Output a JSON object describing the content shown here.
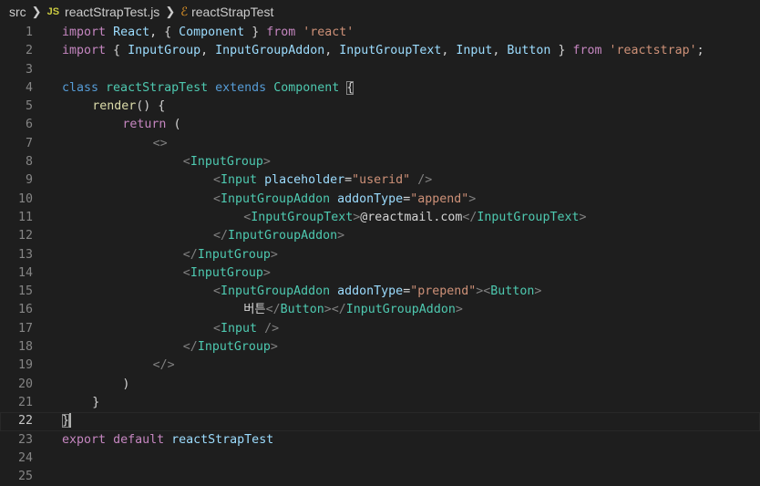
{
  "breadcrumb": {
    "folder": "src",
    "file_badge": "JS",
    "file": "reactStrapTest.js",
    "symbol": "reactStrapTest"
  },
  "editor": {
    "current_line": 22,
    "lines": [
      {
        "n": "1",
        "indent": 0,
        "tokens": [
          [
            "kw",
            "import"
          ],
          [
            "txt",
            " "
          ],
          [
            "var",
            "React"
          ],
          [
            "txt",
            ", { "
          ],
          [
            "var",
            "Component"
          ],
          [
            "txt",
            " } "
          ],
          [
            "kw",
            "from"
          ],
          [
            "txt",
            " "
          ],
          [
            "str",
            "'react'"
          ]
        ]
      },
      {
        "n": "2",
        "indent": 0,
        "tokens": [
          [
            "kw",
            "import"
          ],
          [
            "txt",
            " { "
          ],
          [
            "var",
            "InputGroup"
          ],
          [
            "txt",
            ", "
          ],
          [
            "var",
            "InputGroupAddon"
          ],
          [
            "txt",
            ", "
          ],
          [
            "var",
            "InputGroupText"
          ],
          [
            "txt",
            ", "
          ],
          [
            "var",
            "Input"
          ],
          [
            "txt",
            ", "
          ],
          [
            "var",
            "Button"
          ],
          [
            "txt",
            " } "
          ],
          [
            "kw",
            "from"
          ],
          [
            "txt",
            " "
          ],
          [
            "str",
            "'reactstrap'"
          ],
          [
            "txt",
            ";"
          ]
        ]
      },
      {
        "n": "3",
        "indent": 0,
        "tokens": []
      },
      {
        "n": "4",
        "indent": 0,
        "tokens": [
          [
            "kw2",
            "class"
          ],
          [
            "txt",
            " "
          ],
          [
            "type",
            "reactStrapTest"
          ],
          [
            "txt",
            " "
          ],
          [
            "kw2",
            "extends"
          ],
          [
            "txt",
            " "
          ],
          [
            "type",
            "Component"
          ],
          [
            "txt",
            " "
          ],
          [
            "bm",
            "{"
          ]
        ]
      },
      {
        "n": "5",
        "indent": 1,
        "tokens": [
          [
            "fn",
            "render"
          ],
          [
            "txt",
            "() {"
          ]
        ]
      },
      {
        "n": "6",
        "indent": 2,
        "tokens": [
          [
            "kw",
            "return"
          ],
          [
            "txt",
            " ("
          ]
        ]
      },
      {
        "n": "7",
        "indent": 3,
        "tokens": [
          [
            "tag-p",
            "<>"
          ]
        ]
      },
      {
        "n": "8",
        "indent": 4,
        "tokens": [
          [
            "tag-p",
            "<"
          ],
          [
            "tag",
            "InputGroup"
          ],
          [
            "tag-p",
            ">"
          ]
        ]
      },
      {
        "n": "9",
        "indent": 5,
        "tokens": [
          [
            "tag-p",
            "<"
          ],
          [
            "tag",
            "Input"
          ],
          [
            "txt",
            " "
          ],
          [
            "attr",
            "placeholder"
          ],
          [
            "txt",
            "="
          ],
          [
            "str",
            "\"userid\""
          ],
          [
            "txt",
            " "
          ],
          [
            "tag-p",
            "/>"
          ]
        ]
      },
      {
        "n": "10",
        "indent": 5,
        "tokens": [
          [
            "tag-p",
            "<"
          ],
          [
            "tag",
            "InputGroupAddon"
          ],
          [
            "txt",
            " "
          ],
          [
            "attr",
            "addonType"
          ],
          [
            "txt",
            "="
          ],
          [
            "str",
            "\"append\""
          ],
          [
            "tag-p",
            ">"
          ]
        ]
      },
      {
        "n": "11",
        "indent": 6,
        "tokens": [
          [
            "tag-p",
            "<"
          ],
          [
            "tag",
            "InputGroupText"
          ],
          [
            "tag-p",
            ">"
          ],
          [
            "txt",
            "@reactmail.com"
          ],
          [
            "tag-p",
            "</"
          ],
          [
            "tag",
            "InputGroupText"
          ],
          [
            "tag-p",
            ">"
          ]
        ]
      },
      {
        "n": "12",
        "indent": 5,
        "tokens": [
          [
            "tag-p",
            "</"
          ],
          [
            "tag",
            "InputGroupAddon"
          ],
          [
            "tag-p",
            ">"
          ]
        ]
      },
      {
        "n": "13",
        "indent": 4,
        "tokens": [
          [
            "tag-p",
            "</"
          ],
          [
            "tag",
            "InputGroup"
          ],
          [
            "tag-p",
            ">"
          ]
        ]
      },
      {
        "n": "14",
        "indent": 4,
        "tokens": [
          [
            "tag-p",
            "<"
          ],
          [
            "tag",
            "InputGroup"
          ],
          [
            "tag-p",
            ">"
          ]
        ]
      },
      {
        "n": "15",
        "indent": 5,
        "tokens": [
          [
            "tag-p",
            "<"
          ],
          [
            "tag",
            "InputGroupAddon"
          ],
          [
            "txt",
            " "
          ],
          [
            "attr",
            "addonType"
          ],
          [
            "txt",
            "="
          ],
          [
            "str",
            "\"prepend\""
          ],
          [
            "tag-p",
            ">"
          ],
          [
            "tag-p",
            "<"
          ],
          [
            "tag",
            "Button"
          ],
          [
            "tag-p",
            ">"
          ]
        ]
      },
      {
        "n": "16",
        "indent": 6,
        "tokens": [
          [
            "txt",
            "버튼"
          ],
          [
            "tag-p",
            "</"
          ],
          [
            "tag",
            "Button"
          ],
          [
            "tag-p",
            "></"
          ],
          [
            "tag",
            "InputGroupAddon"
          ],
          [
            "tag-p",
            ">"
          ]
        ]
      },
      {
        "n": "17",
        "indent": 5,
        "tokens": [
          [
            "tag-p",
            "<"
          ],
          [
            "tag",
            "Input"
          ],
          [
            "txt",
            " "
          ],
          [
            "tag-p",
            "/>"
          ]
        ]
      },
      {
        "n": "18",
        "indent": 4,
        "tokens": [
          [
            "tag-p",
            "</"
          ],
          [
            "tag",
            "InputGroup"
          ],
          [
            "tag-p",
            ">"
          ]
        ]
      },
      {
        "n": "19",
        "indent": 3,
        "tokens": [
          [
            "tag-p",
            "</>"
          ]
        ]
      },
      {
        "n": "20",
        "indent": 2,
        "tokens": [
          [
            "txt",
            ")"
          ]
        ]
      },
      {
        "n": "21",
        "indent": 1,
        "tokens": [
          [
            "txt",
            "}"
          ]
        ]
      },
      {
        "n": "22",
        "indent": 0,
        "tokens": [
          [
            "bm",
            "}"
          ],
          [
            "cursor",
            ""
          ]
        ]
      },
      {
        "n": "23",
        "indent": 0,
        "tokens": [
          [
            "kw",
            "export"
          ],
          [
            "txt",
            " "
          ],
          [
            "kw",
            "default"
          ],
          [
            "txt",
            " "
          ],
          [
            "var",
            "reactStrapTest"
          ]
        ]
      },
      {
        "n": "24",
        "indent": 0,
        "tokens": []
      },
      {
        "n": "25",
        "indent": 0,
        "tokens": []
      }
    ]
  }
}
